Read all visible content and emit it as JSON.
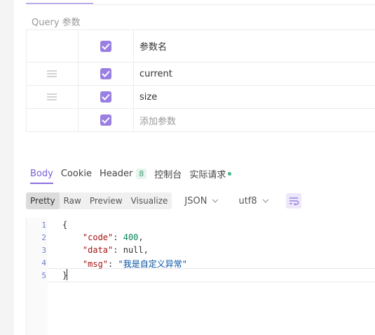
{
  "query_section": {
    "title": "Query 参数",
    "header_label": "参数名",
    "rows": [
      {
        "name": "current",
        "checked": true,
        "placeholder": false
      },
      {
        "name": "size",
        "checked": true,
        "placeholder": false
      },
      {
        "name": "添加参数",
        "checked": true,
        "placeholder": true
      }
    ]
  },
  "response": {
    "tabs": [
      {
        "label": "Body",
        "active": true
      },
      {
        "label": "Cookie"
      },
      {
        "label": "Header",
        "badge": "8"
      },
      {
        "label": "控制台"
      },
      {
        "label": "实际请求",
        "status_dot": true
      }
    ],
    "view_modes": [
      "Pretty",
      "Raw",
      "Preview",
      "Visualize"
    ],
    "active_view_mode": "Pretty",
    "format_select": "JSON",
    "encoding_select": "utf8"
  },
  "editor": {
    "line_numbers": [
      "1",
      "2",
      "3",
      "4",
      "5"
    ],
    "lines": [
      {
        "text": "{"
      },
      {
        "key": "\"code\"",
        "sep": ": ",
        "value": "400",
        "vtype": "num",
        "end": ","
      },
      {
        "key": "\"data\"",
        "sep": ": ",
        "value": "null",
        "vtype": "null",
        "end": ","
      },
      {
        "key": "\"msg\"",
        "sep": ": ",
        "value": "\"我是自定义异常\"",
        "vtype": "str",
        "end": ""
      },
      {
        "text": "}"
      }
    ]
  },
  "colors": {
    "accent": "#8c6fe0",
    "checkbox": "#9a7fe2",
    "status_green": "#41b883"
  }
}
